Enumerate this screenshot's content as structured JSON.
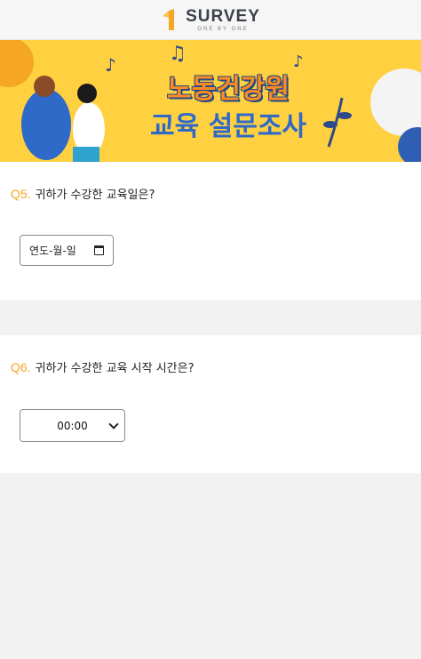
{
  "header": {
    "brand": "SURVEY",
    "brand_number": "1",
    "tagline": "ONE BY ONE"
  },
  "banner": {
    "title_line1": "노동건강원",
    "title_line2": "교육 설문조사",
    "colors": {
      "background": "#ffd03f",
      "accent": "#ff8a20",
      "blue": "#2f6ac8"
    }
  },
  "questions": [
    {
      "number": "Q5.",
      "text": "귀하가 수강한 교육일은?",
      "input_type": "date",
      "placeholder": "연도-월-일"
    },
    {
      "number": "Q6.",
      "text": "귀하가 수강한 교육 시작 시간은?",
      "input_type": "select",
      "selected": "00:00"
    }
  ]
}
